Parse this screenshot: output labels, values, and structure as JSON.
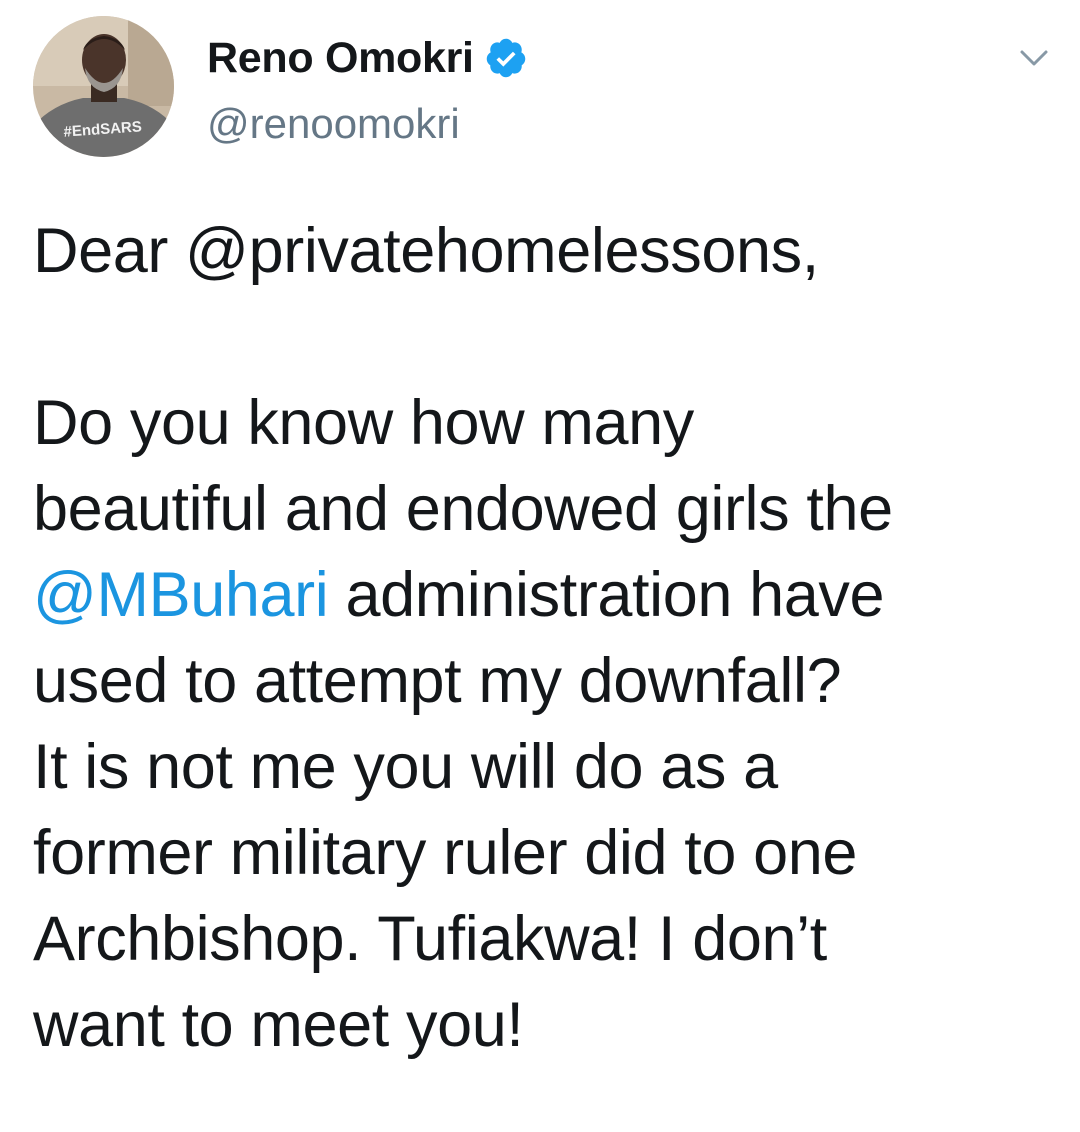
{
  "author": {
    "display_name": "Reno Omokri",
    "handle": "@renoomokri",
    "verified": true,
    "avatar_shirt_text": "#EndSARS"
  },
  "menu": {
    "icon": "chevron-down-icon"
  },
  "tweet": {
    "lines": {
      "l1_text": "Dear @privatehomelessons,",
      "l2_text": "Do you know how many",
      "l3_text": "beautiful and endowed girls the",
      "l4_mention": "@MBuhari",
      "l4_rest": " administration have",
      "l5_text": "used to attempt my downfall?",
      "l6_text": "It is not me you will do as a",
      "l7_text": "former military ruler did to one",
      "l8_text": "Archbishop. Tufiakwa! I don’t",
      "l9_text": "want to meet you!"
    }
  },
  "colors": {
    "link": "#1b95e0",
    "text": "#14171a",
    "secondary": "#657786",
    "verified_badge": "#1da1f2"
  }
}
